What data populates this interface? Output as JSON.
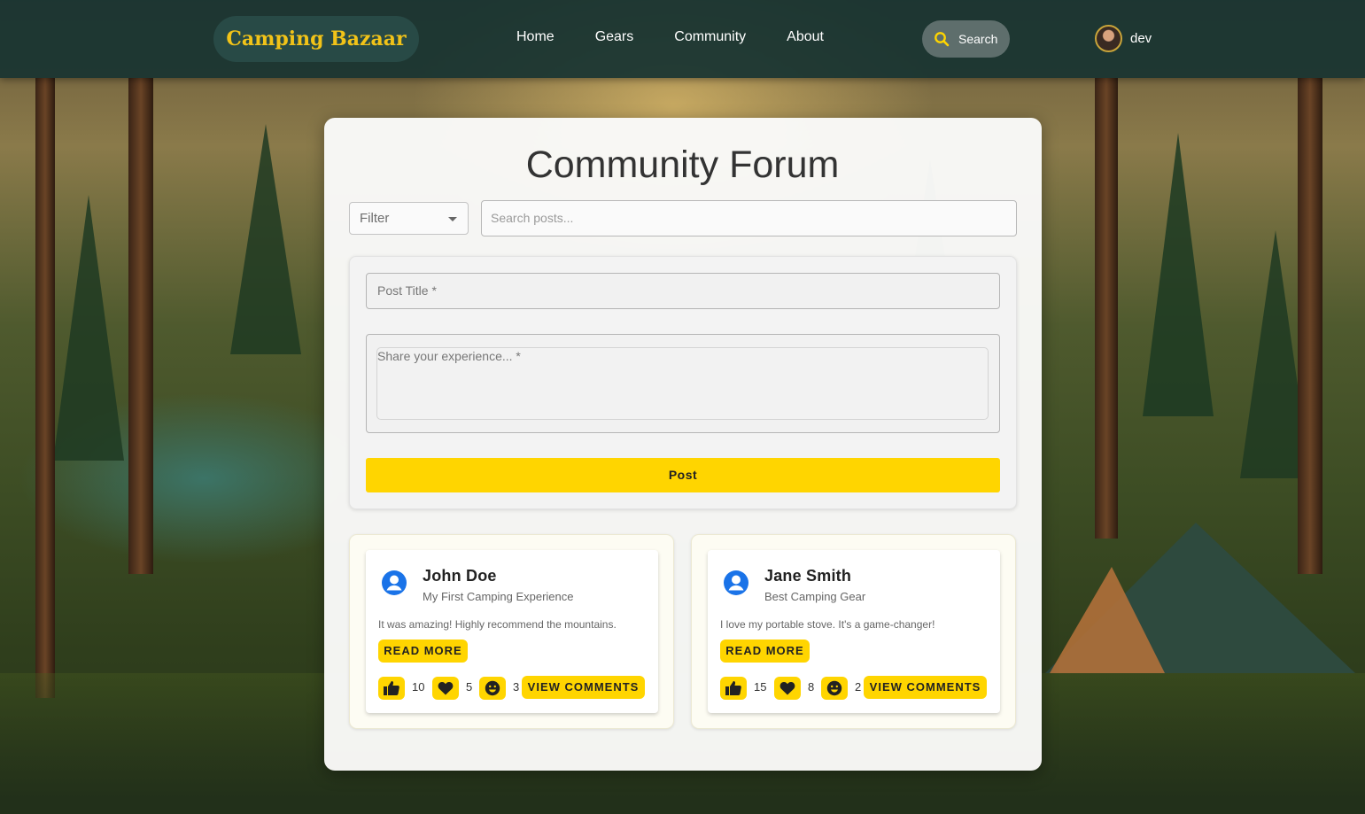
{
  "brand": {
    "name": "Camping Bazaar"
  },
  "nav": {
    "links": [
      "Home",
      "Gears",
      "Community",
      "About"
    ]
  },
  "header_search": {
    "label": "Search"
  },
  "user": {
    "name": "dev"
  },
  "forum": {
    "title": "Community Forum",
    "filter_label": "Filter",
    "search_placeholder": "Search posts...",
    "post_title_placeholder": "Post Title *",
    "experience_placeholder": "Share your experience... *",
    "post_button": "Post"
  },
  "posts": [
    {
      "author": "John Doe",
      "title": "My First Camping Experience",
      "body": "It was amazing! Highly recommend the mountains.",
      "read_more": "READ MORE",
      "likes": "10",
      "hearts": "5",
      "smiles": "3",
      "view_comments": "VIEW COMMENTS"
    },
    {
      "author": "Jane Smith",
      "title": "Best Camping Gear",
      "body": "I love my portable stove. It's a game-changer!",
      "read_more": "READ MORE",
      "likes": "15",
      "hearts": "8",
      "smiles": "2",
      "view_comments": "VIEW COMMENTS"
    }
  ],
  "colors": {
    "accent": "#ffd500",
    "brand_text": "#f2c318",
    "navbar": "#183432",
    "avatar_icon": "#1a73e8"
  },
  "icons": {
    "search": "search-icon",
    "like": "thumbs-up-icon",
    "heart": "heart-icon",
    "smile": "smile-icon",
    "author": "account-circle-icon",
    "dropdown": "chevron-down-icon"
  }
}
